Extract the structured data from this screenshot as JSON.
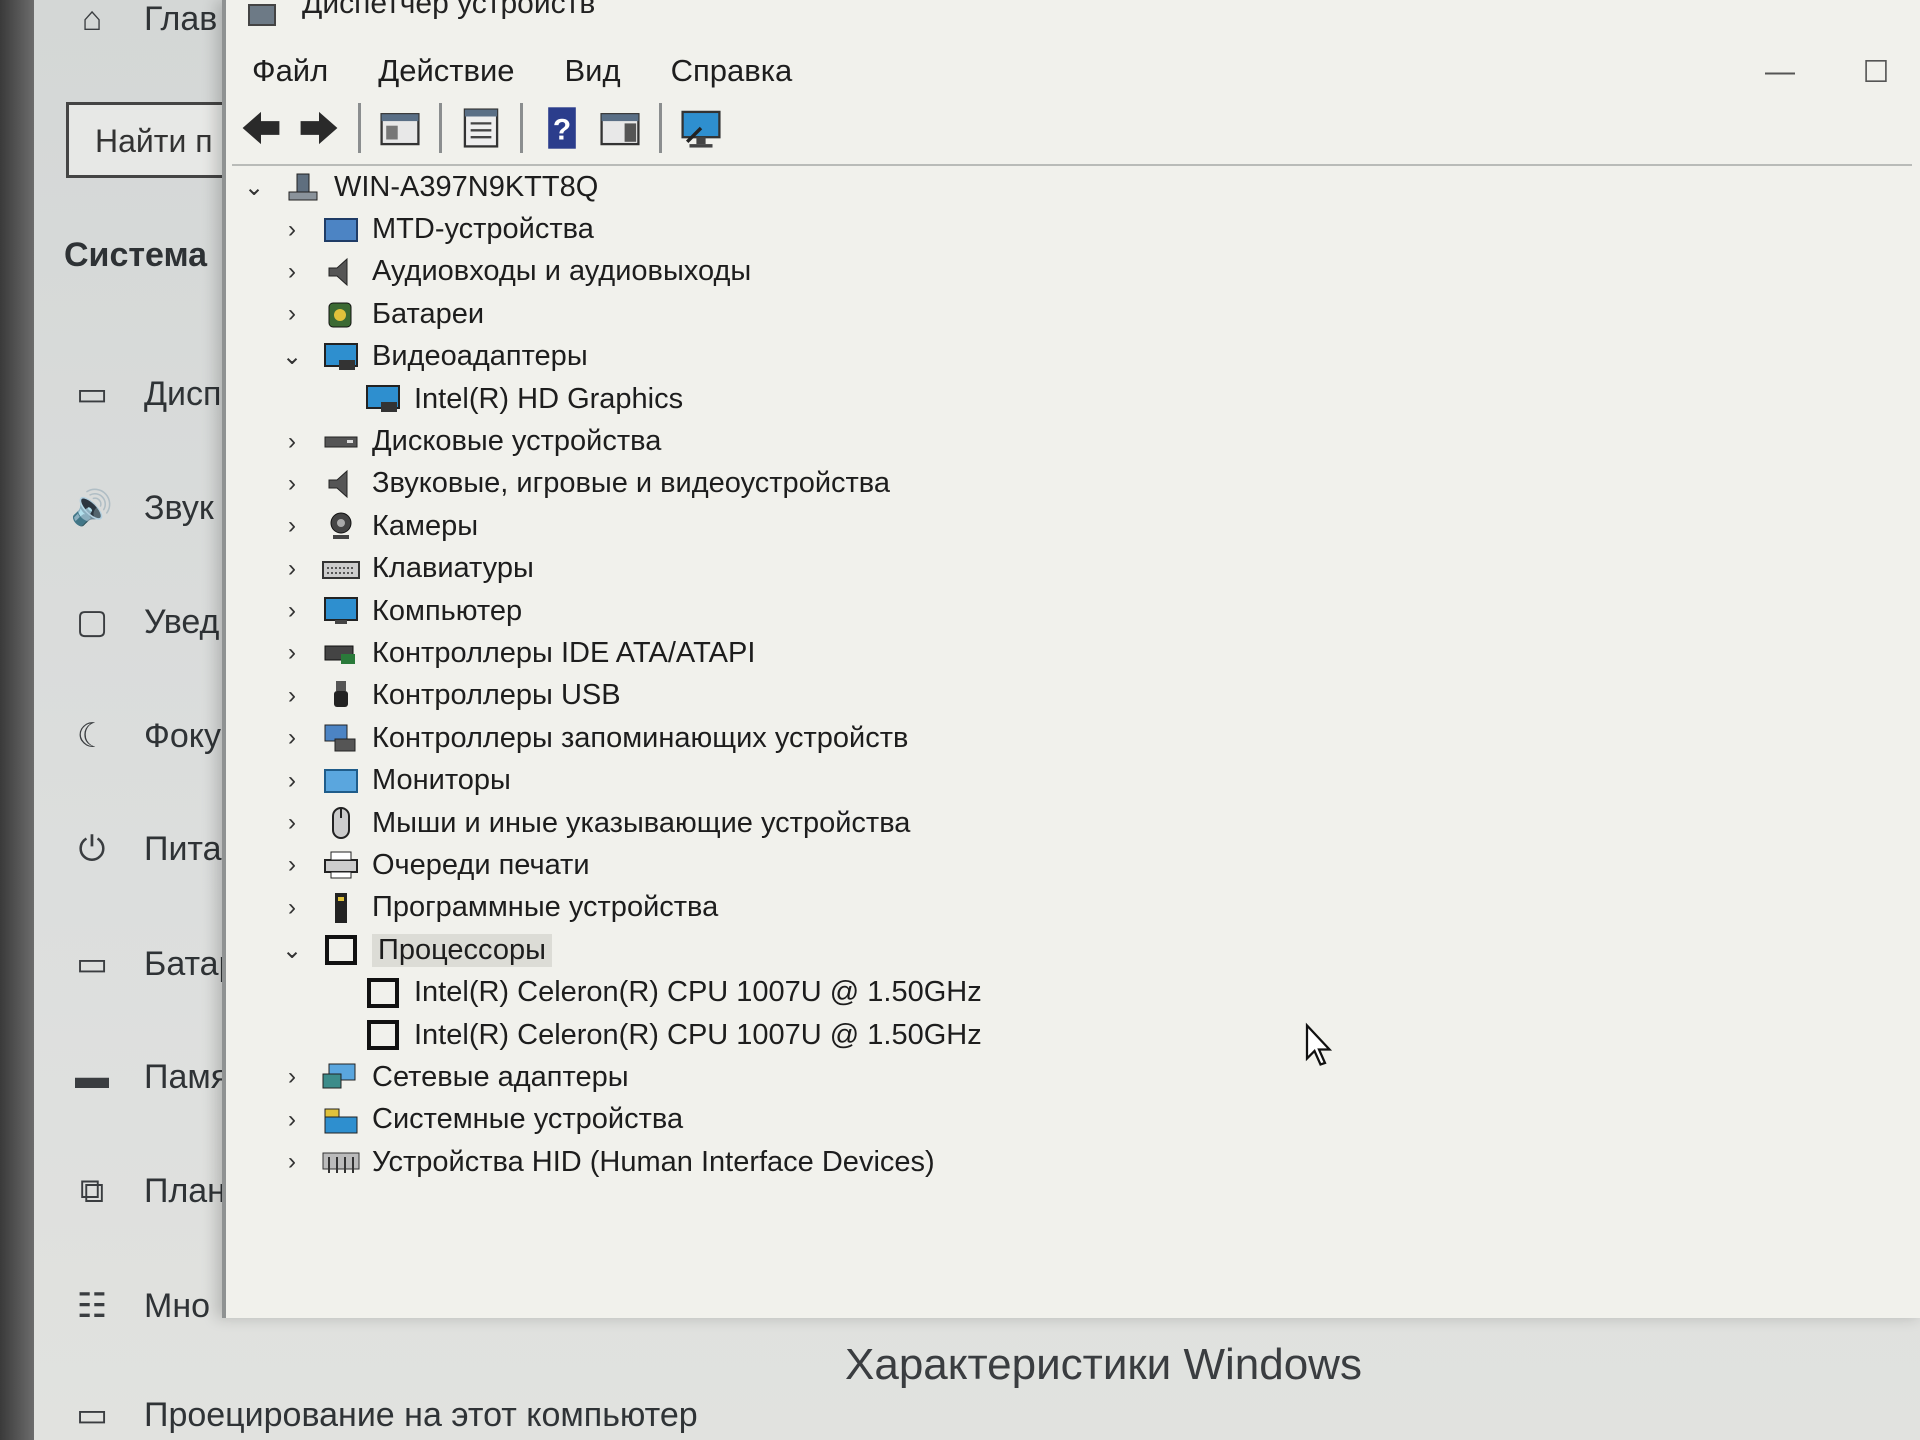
{
  "settings": {
    "nav_home": "Глав",
    "search_placeholder": "Найти п",
    "section_title": "Система",
    "items": [
      {
        "icon": "monitor-icon",
        "label": "Дисп"
      },
      {
        "icon": "speaker-icon",
        "label": "Звук"
      },
      {
        "icon": "notification-icon",
        "label": "Увед"
      },
      {
        "icon": "moon-icon",
        "label": "Фоку"
      },
      {
        "icon": "power-icon",
        "label": "Пита"
      },
      {
        "icon": "battery-icon",
        "label": "Батар"
      },
      {
        "icon": "storage-icon",
        "label": "Памя"
      },
      {
        "icon": "tablet-icon",
        "label": "План"
      },
      {
        "icon": "multitask-icon",
        "label": "Мно"
      }
    ],
    "project_label": "Проецирование на этот компьютер",
    "windows_specs": "Характеристики Windows"
  },
  "devmgr": {
    "title": "Диспетчер устройств",
    "menu": [
      "Файл",
      "Действие",
      "Вид",
      "Справка"
    ],
    "toolbar": [
      "back-icon",
      "forward-icon",
      "show-hide-tree-icon",
      "properties-icon",
      "help-icon",
      "action-pane-icon",
      "scan-hardware-icon"
    ],
    "root": "WIN-A397N9KTT8Q",
    "categories": [
      {
        "label": "MTD-устройства",
        "icon": "mtd-icon",
        "expanded": false
      },
      {
        "label": "Аудиовходы и аудиовыходы",
        "icon": "audio-icon",
        "expanded": false
      },
      {
        "label": "Батареи",
        "icon": "battery-icon",
        "expanded": false
      },
      {
        "label": "Видеоадаптеры",
        "icon": "display-adapter-icon",
        "expanded": true,
        "children": [
          "Intel(R) HD Graphics"
        ]
      },
      {
        "label": "Дисковые устройства",
        "icon": "disk-icon",
        "expanded": false
      },
      {
        "label": "Звуковые, игровые и видеоустройства",
        "icon": "sound-icon",
        "expanded": false
      },
      {
        "label": "Камеры",
        "icon": "camera-icon",
        "expanded": false
      },
      {
        "label": "Клавиатуры",
        "icon": "keyboard-icon",
        "expanded": false
      },
      {
        "label": "Компьютер",
        "icon": "computer-icon",
        "expanded": false
      },
      {
        "label": "Контроллеры IDE ATA/ATAPI",
        "icon": "ide-icon",
        "expanded": false
      },
      {
        "label": "Контроллеры USB",
        "icon": "usb-icon",
        "expanded": false
      },
      {
        "label": "Контроллеры запоминающих устройств",
        "icon": "storage-controller-icon",
        "expanded": false
      },
      {
        "label": "Мониторы",
        "icon": "monitor-icon",
        "expanded": false
      },
      {
        "label": "Мыши и иные указывающие устройства",
        "icon": "mouse-icon",
        "expanded": false
      },
      {
        "label": "Очереди печати",
        "icon": "printer-icon",
        "expanded": false
      },
      {
        "label": "Программные устройства",
        "icon": "software-device-icon",
        "expanded": false
      },
      {
        "label": "Процессоры",
        "icon": "processor-icon",
        "expanded": true,
        "selected": true,
        "children": [
          "Intel(R) Celeron(R) CPU 1007U @ 1.50GHz",
          "Intel(R) Celeron(R) CPU 1007U @ 1.50GHz"
        ]
      },
      {
        "label": "Сетевые адаптеры",
        "icon": "network-icon",
        "expanded": false
      },
      {
        "label": "Системные устройства",
        "icon": "system-icon",
        "expanded": false
      },
      {
        "label": "Устройства HID (Human Interface Devices)",
        "icon": "hid-icon",
        "expanded": false
      }
    ]
  }
}
